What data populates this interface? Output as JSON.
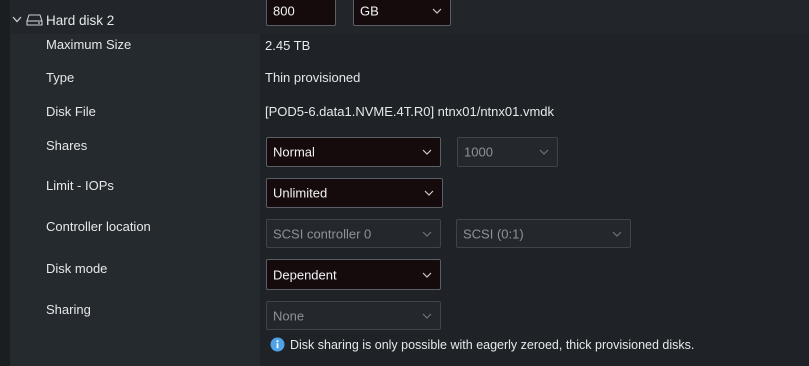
{
  "disk": {
    "title": "Hard disk 2",
    "size_value": "800",
    "size_unit": "GB"
  },
  "rows": [
    {
      "label": "Maximum Size",
      "value": "2.45 TB"
    },
    {
      "label": "Type",
      "value": "Thin provisioned"
    },
    {
      "label": "Disk File",
      "value": "[POD5-6.data1.NVME.4T.R0] ntnx01/ntnx01.vmdk"
    },
    {
      "label": "Shares",
      "select": "Normal",
      "secondary": "1000"
    },
    {
      "label": "Limit - IOPs",
      "select": "Unlimited"
    },
    {
      "label": "Controller location",
      "select": "SCSI controller 0",
      "secondary": "SCSI (0:1)"
    },
    {
      "label": "Disk mode",
      "select": "Dependent"
    },
    {
      "label": "Sharing",
      "select": "None",
      "info": "Disk sharing is only possible with eagerly zeroed, thick provisioned disks."
    }
  ],
  "colors": {
    "info_icon": "#4ea3e6"
  },
  "icons": {
    "expand": "chevron-down-icon",
    "disk": "hard-disk-icon",
    "dropdown": "chevron-down-icon",
    "info": "info-icon"
  }
}
